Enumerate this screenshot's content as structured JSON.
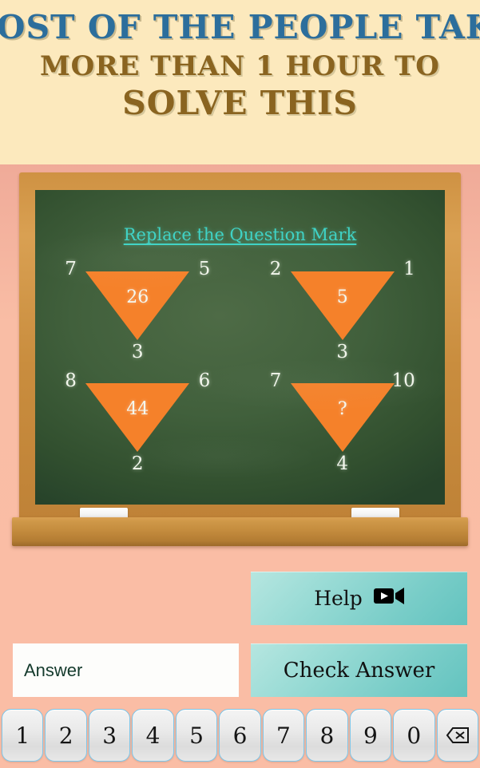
{
  "banner": {
    "line1": "MOST OF THE PEOPLE TAKE",
    "line2": "MORE THAN 1 HOUR TO",
    "line3": "SOLVE THIS",
    "line1_color": "#2c6e9c",
    "line2_color": "#8a6420",
    "background": "#fce9bd"
  },
  "board": {
    "title": "Replace the Question Mark",
    "title_color": "#3fd3c6",
    "surface_color": "#41603c",
    "frame_color": "#cf9243",
    "triangle_color": "#f5812a",
    "chalk_color": "#ffffff"
  },
  "puzzle": {
    "triangles": [
      {
        "left": "7",
        "right": "5",
        "bottom": "3",
        "center": "26"
      },
      {
        "left": "2",
        "right": "1",
        "bottom": "3",
        "center": "5"
      },
      {
        "left": "8",
        "right": "6",
        "bottom": "2",
        "center": "44"
      },
      {
        "left": "7",
        "right": "10",
        "bottom": "4",
        "center": "?"
      }
    ]
  },
  "controls": {
    "help_label": "Help",
    "help_icon": "video-camera-icon",
    "check_label": "Check Answer",
    "answer_value": "",
    "answer_placeholder": "Answer",
    "button_color": "#79cdc8"
  },
  "keypad": {
    "keys": [
      "1",
      "2",
      "3",
      "4",
      "5",
      "6",
      "7",
      "8",
      "9",
      "0"
    ],
    "backspace_icon": "backspace-icon"
  }
}
